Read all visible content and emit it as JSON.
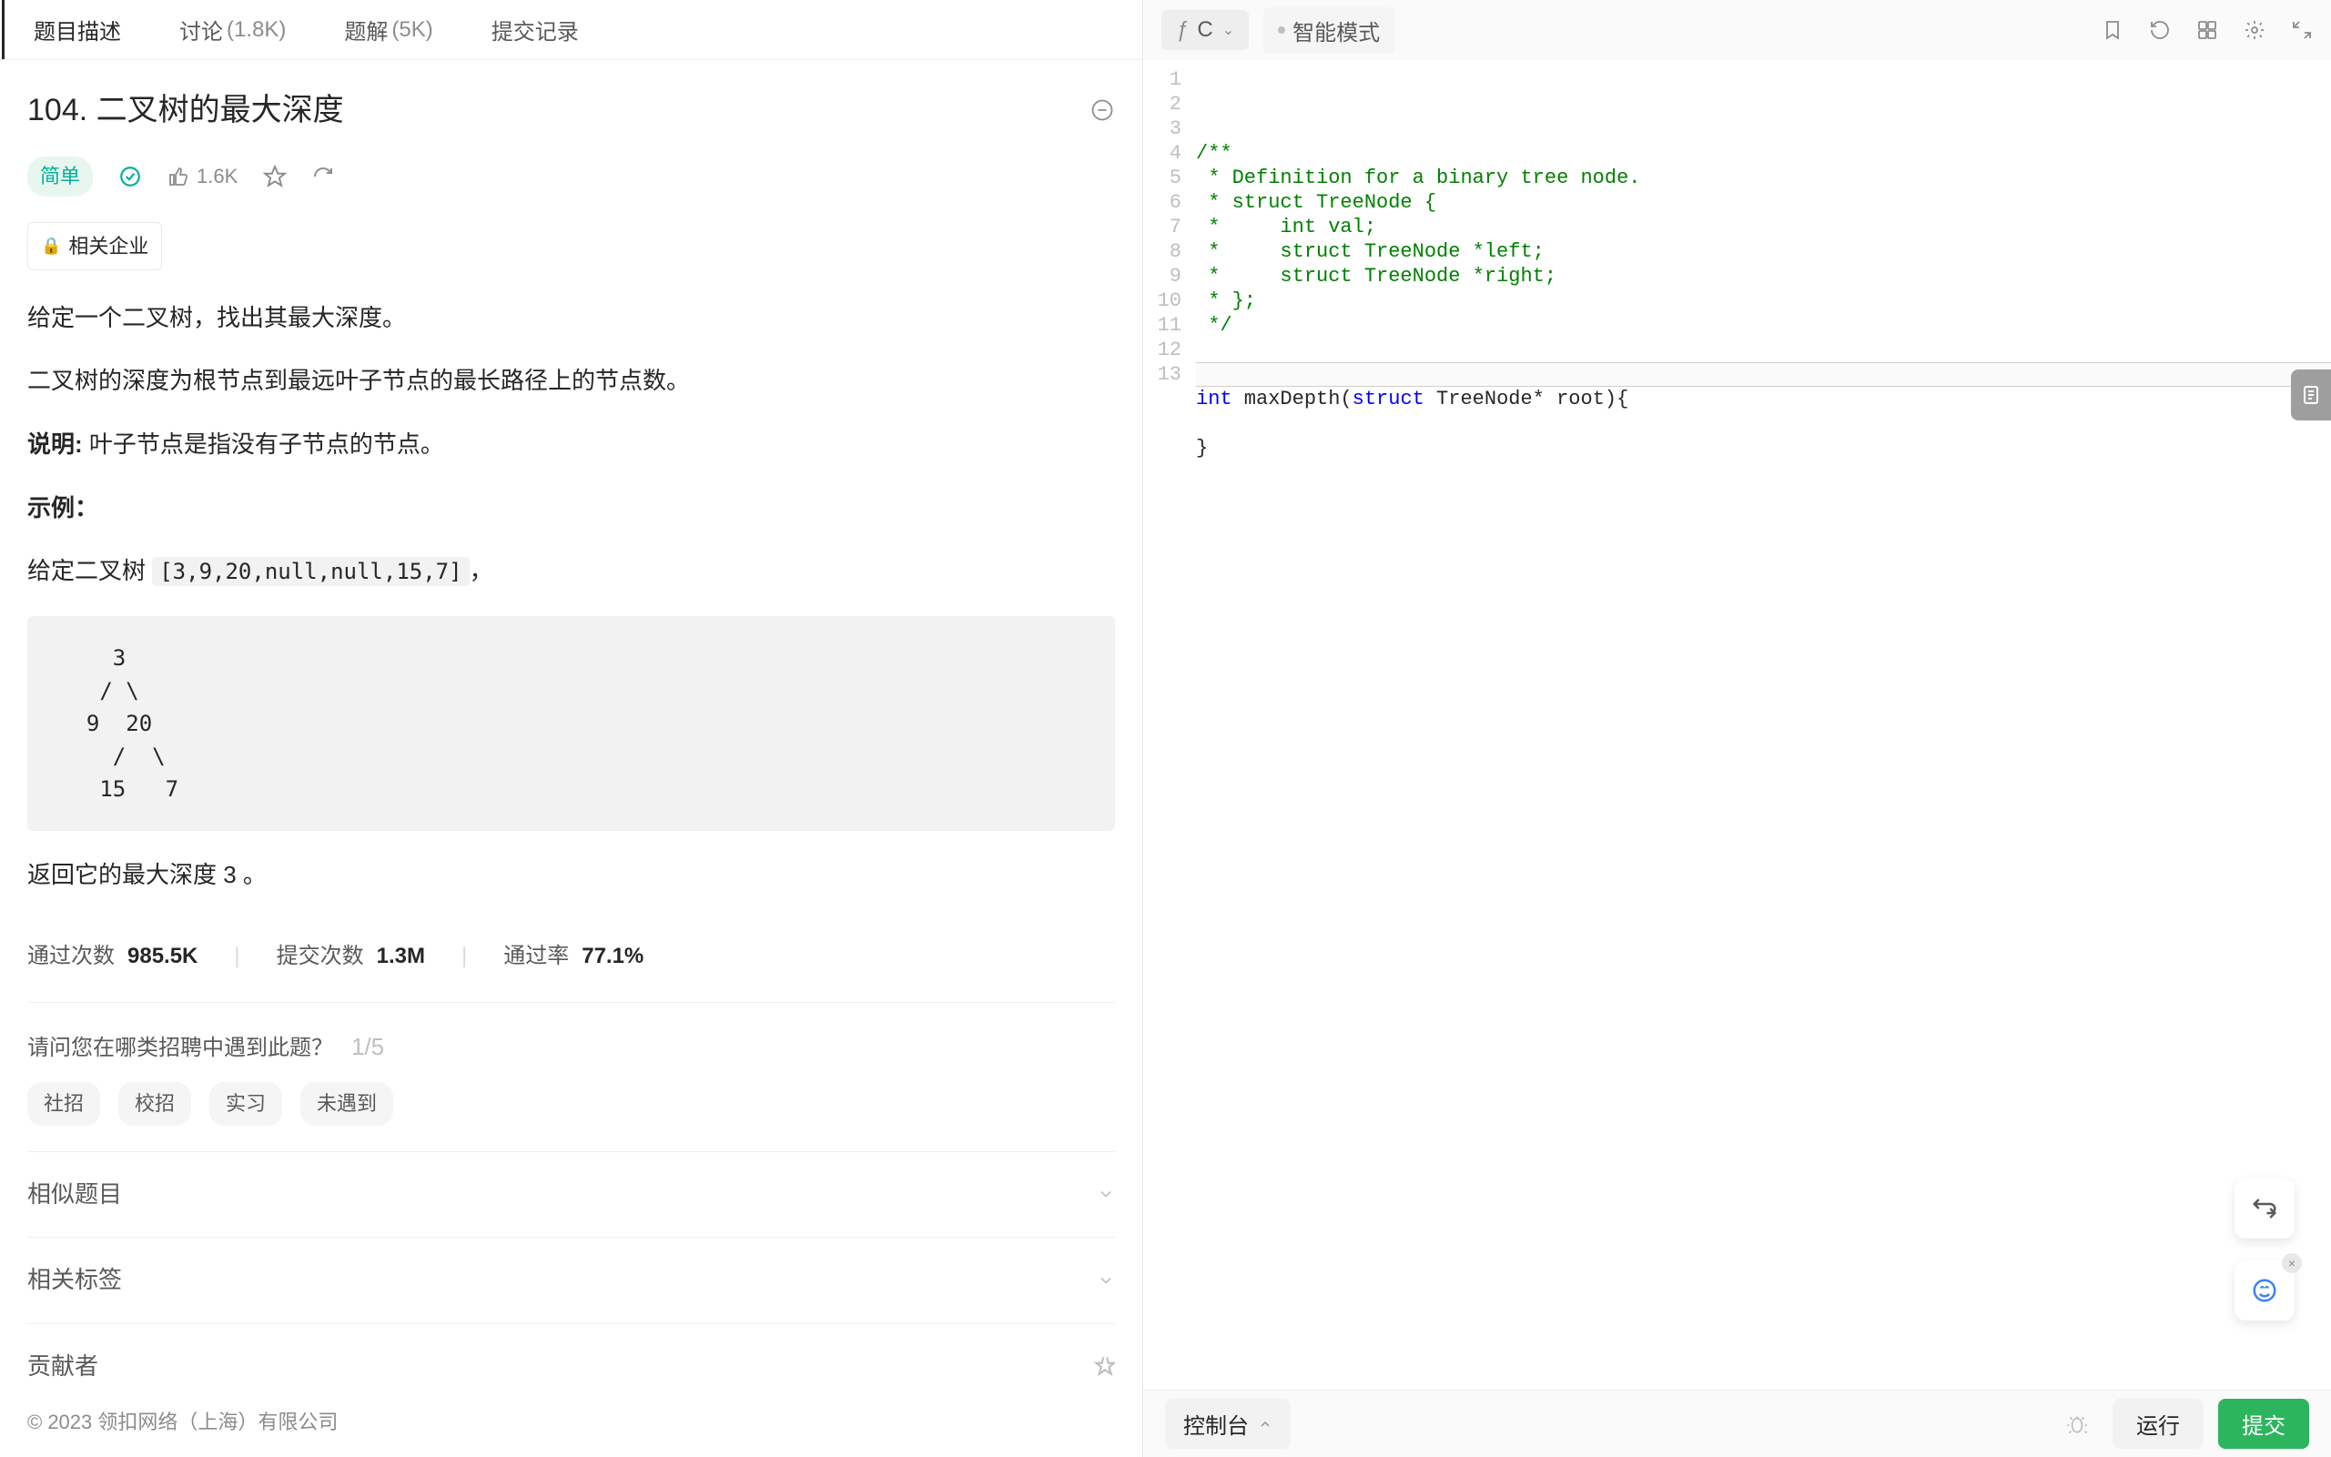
{
  "tabs": {
    "description": "题目描述",
    "discussion": "讨论",
    "discussion_count": "(1.8K)",
    "solutions": "题解",
    "solutions_count": "(5K)",
    "submissions": "提交记录"
  },
  "problem": {
    "title": "104. 二叉树的最大深度",
    "difficulty": "简单",
    "likes": "1.6K",
    "company_badge": "相关企业"
  },
  "desc": {
    "p1": "给定一个二叉树，找出其最大深度。",
    "p2": "二叉树的深度为根节点到最远叶子节点的最长路径上的节点数。",
    "note_label": "说明:",
    "note_text": " 叶子节点是指没有子节点的节点。",
    "example_label": "示例：",
    "example_given": "给定二叉树 ",
    "example_input": "[3,9,20,null,null,15,7]",
    "example_comma": "，",
    "tree": "    3\n   / \\\n  9  20\n    /  \\\n   15   7",
    "result": "返回它的最大深度 3 。"
  },
  "stats": {
    "pass_label": "通过次数",
    "pass_value": "985.5K",
    "submit_label": "提交次数",
    "submit_value": "1.3M",
    "rate_label": "通过率",
    "rate_value": "77.1%"
  },
  "survey": {
    "question": "请问您在哪类招聘中遇到此题？",
    "step": "1/5",
    "options": [
      "社招",
      "校招",
      "实习",
      "未遇到"
    ]
  },
  "sections": {
    "similar": "相似题目",
    "tags": "相关标签",
    "contributors": "贡献者"
  },
  "footer": "© 2023 领扣网络（上海）有限公司",
  "editor": {
    "language": "C",
    "smart_mode": "智能模式",
    "line_count": 13,
    "current_line": 13,
    "code_lines": [
      {
        "type": "cm",
        "text": "/**"
      },
      {
        "type": "cm",
        "text": " * Definition for a binary tree node."
      },
      {
        "type": "cm",
        "text": " * struct TreeNode {"
      },
      {
        "type": "cm",
        "text": " *     int val;"
      },
      {
        "type": "cm",
        "text": " *     struct TreeNode *left;"
      },
      {
        "type": "cm",
        "text": " *     struct TreeNode *right;"
      },
      {
        "type": "cm",
        "text": " * };"
      },
      {
        "type": "cm",
        "text": " */"
      },
      {
        "type": "",
        "text": ""
      },
      {
        "type": "",
        "text": ""
      },
      {
        "type": "fn",
        "text": "int maxDepth(struct TreeNode* root){"
      },
      {
        "type": "",
        "text": ""
      },
      {
        "type": "",
        "text": "}"
      }
    ]
  },
  "console": {
    "toggle": "控制台",
    "run": "运行",
    "submit": "提交"
  },
  "icons": {
    "more": "⊖",
    "check": "✓",
    "like": "👍",
    "star": "☆",
    "share": "↻",
    "lock": "🔒",
    "chevron_down": "⌄",
    "bookmark": "🔖",
    "undo": "↺",
    "keyboard": "⌘",
    "settings": "⚙",
    "collapse": "⤡",
    "file": "📄",
    "swap": "⇄",
    "chat": "💬",
    "bug": "🐞",
    "caret_up": "^"
  }
}
